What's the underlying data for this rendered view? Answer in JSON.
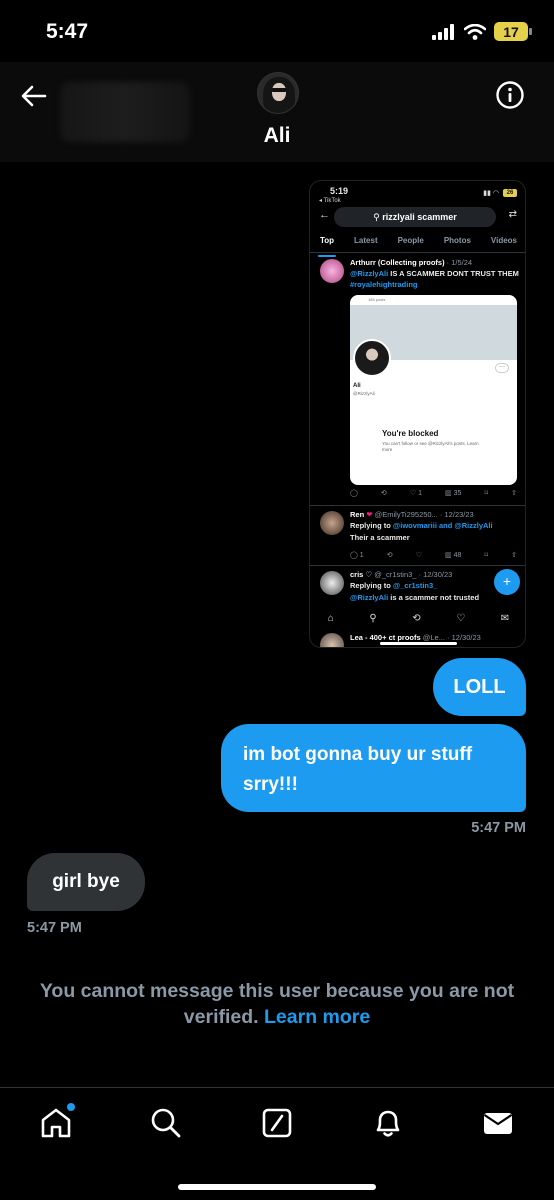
{
  "status_bar": {
    "time": "5:47",
    "battery": "17"
  },
  "header": {
    "contact_name": "Ali"
  },
  "screenshot": {
    "time": "5:19",
    "back_app": "◂ TikTok",
    "battery": "26",
    "search_query": "rizzlyali scammer",
    "tabs": [
      "Top",
      "Latest",
      "People",
      "Photos",
      "Videos"
    ],
    "post1": {
      "author": "Arthurr (Collecting proofs)",
      "date": "· 1/5/24",
      "mention": "@RizzlyAli",
      "text": " IS A SCAMMER DONT TRUST THEM ",
      "hashtag": "#royalehightrading",
      "embed_name": "Ali",
      "embed_handle": "@RizzlyAli",
      "embed_posts": "185 posts",
      "embed_title": "You're blocked",
      "embed_sub": "You can't follow or see @RizzlyAli's posts. Learn more",
      "stats": [
        "1",
        "35"
      ]
    },
    "post2": {
      "author": "Ren",
      "handle": "@EmilyTi295250... · 12/23/23",
      "replying": "Replying to ",
      "mentions": "@iwovmariii and @RizzlyAli",
      "text": "Their a scammer",
      "stats": [
        "1",
        "48"
      ]
    },
    "post3": {
      "author": "cris ♡",
      "handle": "@_cr1stin3_ · 12/30/23",
      "replying": "Replying to ",
      "mention": "@_cr1stin3_",
      "mention2": "@RizzlyAli",
      "text": " is a scammer not trusted"
    },
    "post4": {
      "author": "Lea - 400+ ct proofs",
      "handle": "@Le... · 12/30/23"
    }
  },
  "messages": {
    "sent_1": "LOLL",
    "sent_2": "im bot gonna buy ur stuff srry!!!",
    "sent_time": "5:47 PM",
    "received_1": "girl bye",
    "received_time": "5:47 PM"
  },
  "notice": {
    "text": "You cannot message this user because you are not verified. ",
    "link": "Learn more"
  },
  "colors": {
    "accent": "#1d9bf0",
    "received_bubble": "#2f3336",
    "background": "#000000"
  }
}
